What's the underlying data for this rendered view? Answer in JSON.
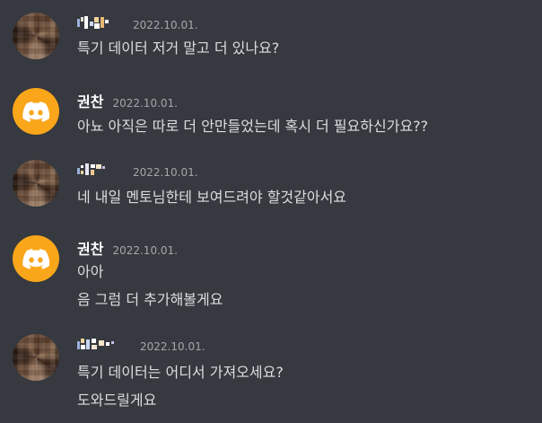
{
  "messages": [
    {
      "author": "",
      "avatar": "pixelated-avatar",
      "timestamp": "2022.10.01.",
      "lines": [
        "특기 데이터 저거 말고 더 있나요?"
      ]
    },
    {
      "author": "권찬",
      "avatar": "discord-logo",
      "timestamp": "2022.10.01.",
      "lines": [
        "아뇨 아직은 따로 더 안만들었는데 혹시 더 필요하신가요??"
      ]
    },
    {
      "author": "",
      "avatar": "pixelated-avatar",
      "timestamp": "2022.10.01.",
      "lines": [
        "네 내일 멘토님한테 보여드려야 할것같아서요"
      ]
    },
    {
      "author": "권찬",
      "avatar": "discord-logo",
      "timestamp": "2022.10.01.",
      "lines": [
        "아아",
        "음 그럼 더 추가해볼게요"
      ]
    },
    {
      "author": "",
      "avatar": "pixelated-avatar",
      "timestamp": "2022.10.01.",
      "lines": [
        "특기 데이터는 어디서 가져오세요?",
        "도와드릴게요"
      ]
    }
  ],
  "colors": {
    "background": "#36393f",
    "discord_avatar": "#faa61a",
    "text": "#dcddde",
    "username": "#ffffff",
    "timestamp": "#a3a6aa"
  }
}
